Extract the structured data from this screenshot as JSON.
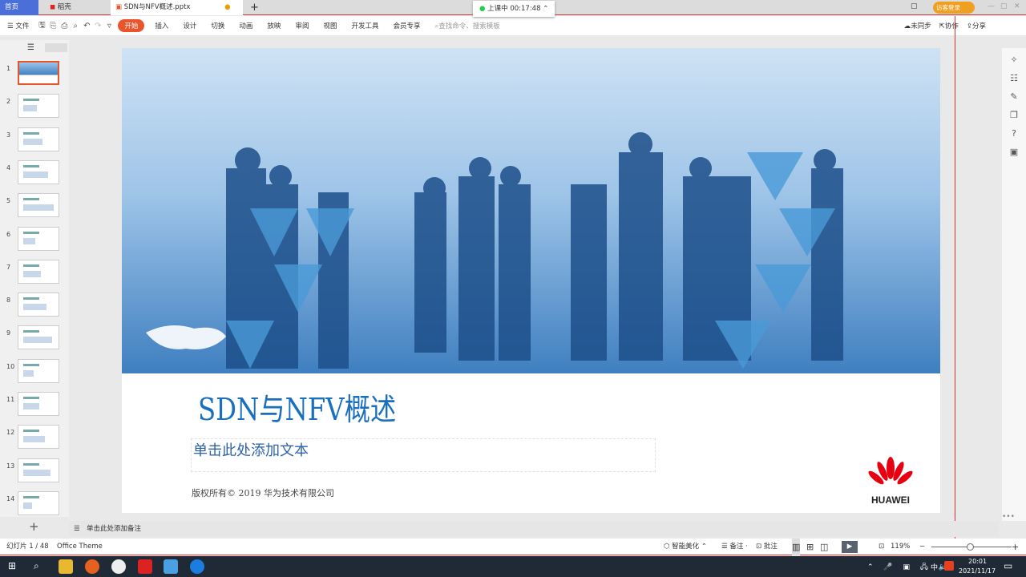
{
  "tabs": [
    {
      "label": "首页"
    },
    {
      "label": "稻壳"
    },
    {
      "label": "SDN与NFV概述.pptx"
    }
  ],
  "class_timer": {
    "label": "上课中 00:17:48"
  },
  "login_badge": "访客登录",
  "menu": {
    "file": "文件",
    "items": [
      "开始",
      "插入",
      "设计",
      "切换",
      "动画",
      "放映",
      "审阅",
      "视图",
      "开发工具",
      "会员专享"
    ],
    "search_placeholder": "查找命令、搜索模板"
  },
  "right_actions": {
    "sync": "未同步",
    "collab": "协作",
    "share": "分享"
  },
  "thumbnails": [
    "1",
    "2",
    "3",
    "4",
    "5",
    "6",
    "7",
    "8",
    "9",
    "10",
    "11",
    "12",
    "13",
    "14"
  ],
  "slide": {
    "title": "SDN与NFV概述",
    "subtitle_placeholder": "单击此处添加文本",
    "copyright": "版权所有© 2019 华为技术有限公司",
    "logo_text": "HUAWEI"
  },
  "notes_placeholder": "单击此处添加备注",
  "status": {
    "slide_counter": "幻灯片 1 / 48",
    "theme": "Office Theme",
    "beautify": "智能美化",
    "notes": "备注",
    "comments": "批注",
    "zoom": "119%"
  },
  "taskbar": {
    "time": "20:01",
    "date": "2021/11/17",
    "ime": "中"
  },
  "colors": {
    "accent": "#e8542b",
    "title": "#1a6fbf",
    "huawei": "#e60012"
  }
}
